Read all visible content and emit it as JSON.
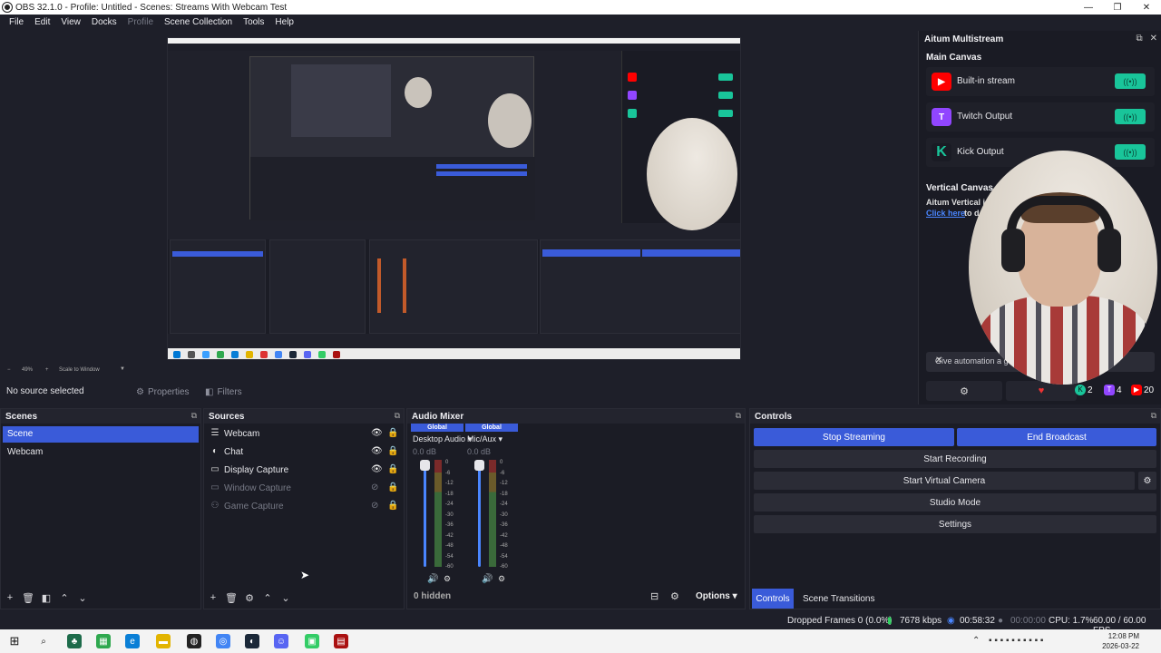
{
  "window": {
    "title": "OBS 32.1.0 - Profile: Untitled - Scenes: Streams With Webcam Test"
  },
  "menu": [
    {
      "label": "File",
      "enabled": true
    },
    {
      "label": "Edit",
      "enabled": true
    },
    {
      "label": "View",
      "enabled": true
    },
    {
      "label": "Docks",
      "enabled": true
    },
    {
      "label": "Profile",
      "enabled": false
    },
    {
      "label": "Scene Collection",
      "enabled": true
    },
    {
      "label": "Tools",
      "enabled": true
    },
    {
      "label": "Help",
      "enabled": true
    }
  ],
  "preview": {
    "zoom": "49%",
    "scale_mode": "Scale to Window"
  },
  "context": {
    "no_source": "No source selected",
    "properties": "Properties",
    "filters": "Filters"
  },
  "multistream": {
    "title": "Aitum Multistream",
    "main_canvas": "Main Canvas",
    "outputs": [
      {
        "name": "Built-in stream",
        "icon": "youtube-icon",
        "color": "#ff0000",
        "glyph": "▶"
      },
      {
        "name": "Twitch Output",
        "icon": "twitch-icon",
        "color": "#9146ff",
        "glyph": "T"
      },
      {
        "name": "Kick Output",
        "icon": "kick-icon",
        "color": "#1a1b24",
        "glyph": "K"
      }
    ],
    "vertical_canvas": "Vertical Canvas",
    "vertical_text": "Aitum Vertical i",
    "click_here": "Click here",
    "click_tail": " to d",
    "automation": "Give automation a go",
    "counts": {
      "kick": "2",
      "twitch": "4",
      "youtube": "20"
    },
    "toggle_glyph": "((•))"
  },
  "scenes": {
    "title": "Scenes",
    "items": [
      "Scene",
      "Webcam"
    ],
    "selected": 0
  },
  "sources": {
    "title": "Sources",
    "items": [
      {
        "name": "Webcam",
        "icon": "camera-icon",
        "glyph": "☰",
        "visible": true
      },
      {
        "name": "Chat",
        "icon": "browser-icon",
        "glyph": "◐",
        "visible": true
      },
      {
        "name": "Display Capture",
        "icon": "monitor-icon",
        "glyph": "▭",
        "visible": true
      },
      {
        "name": "Window Capture",
        "icon": "window-icon",
        "glyph": "▭",
        "visible": false
      },
      {
        "name": "Game Capture",
        "icon": "gamepad-icon",
        "glyph": "⚇",
        "visible": false
      }
    ]
  },
  "mixer": {
    "title": "Audio Mixer",
    "channels": [
      {
        "label": "Global",
        "name": "Desktop Audio",
        "db": "0.0 dB"
      },
      {
        "label": "Global",
        "name": "Mic/Aux",
        "db": "0.0 dB"
      }
    ],
    "scale": [
      "0",
      "-6",
      "-12",
      "-18",
      "-24",
      "-30",
      "-36",
      "-42",
      "-48",
      "-54",
      "-60"
    ],
    "hidden": "0 hidden",
    "options": "Options"
  },
  "controls": {
    "title": "Controls",
    "stop_streaming": "Stop Streaming",
    "end_broadcast": "End Broadcast",
    "start_recording": "Start Recording",
    "start_virtual_camera": "Start Virtual Camera",
    "studio_mode": "Studio Mode",
    "settings": "Settings",
    "tab_controls": "Controls",
    "tab_transitions": "Scene Transitions"
  },
  "status": {
    "dropped": "Dropped Frames 0 (0.0%)",
    "bitrate": "7678 kbps",
    "stream_time": "00:58:32",
    "rec_time": "00:00:00",
    "cpu": "CPU: 1.7%",
    "fps": "60.00 / 60.00 FPS"
  },
  "taskbar": {
    "time": "12:08 PM",
    "date": "2026-03-22"
  },
  "colors": {
    "accent": "#3a5bd9",
    "kick": "#19c59a",
    "twitch": "#9146ff",
    "youtube": "#ff0000",
    "bg": "#1e1f29"
  }
}
